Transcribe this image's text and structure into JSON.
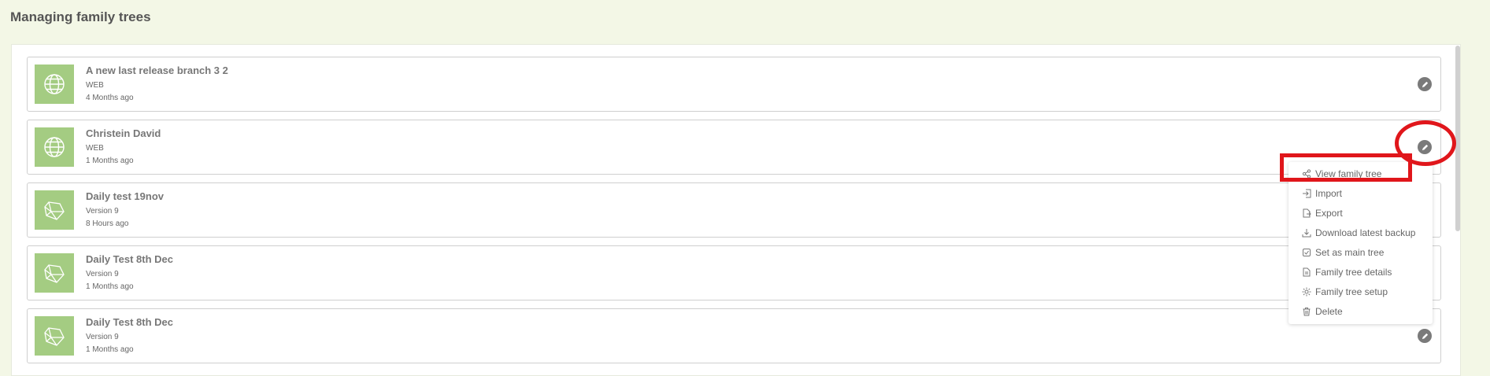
{
  "page": {
    "title": "Managing family trees"
  },
  "trees": [
    {
      "name": "A new last release branch 3 2",
      "type": "WEB",
      "time": "4 Months ago",
      "icon": "globe-icon"
    },
    {
      "name": "Christein David",
      "type": "WEB",
      "time": "1 Months ago",
      "icon": "globe-icon"
    },
    {
      "name": "Daily test 19nov",
      "type": "Version 9",
      "time": "8 Hours ago",
      "icon": "gem-icon"
    },
    {
      "name": "Daily Test 8th Dec",
      "type": "Version 9",
      "time": "1 Months ago",
      "icon": "gem-icon"
    },
    {
      "name": "Daily Test 8th Dec",
      "type": "Version 9",
      "time": "1 Months ago",
      "icon": "gem-icon"
    }
  ],
  "menu": {
    "items": [
      {
        "label": "View family tree",
        "icon": "share-icon"
      },
      {
        "label": "Import",
        "icon": "import-icon"
      },
      {
        "label": "Export",
        "icon": "export-icon"
      },
      {
        "label": "Download latest backup",
        "icon": "download-icon"
      },
      {
        "label": "Set as main tree",
        "icon": "checkbox-icon"
      },
      {
        "label": "Family tree details",
        "icon": "document-icon"
      },
      {
        "label": "Family tree setup",
        "icon": "gear-icon"
      },
      {
        "label": "Delete",
        "icon": "trash-icon"
      }
    ]
  },
  "colors": {
    "thumb": "#a4cc82",
    "annotation": "#e0161b",
    "background": "#f3f7e6"
  }
}
